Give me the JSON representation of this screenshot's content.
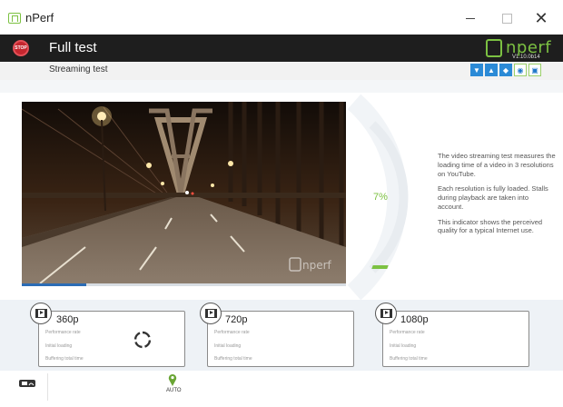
{
  "window": {
    "title": "nPerf",
    "controls": {
      "minimize": "minimize-icon",
      "maximize": "maximize-icon",
      "close": "✕"
    }
  },
  "header": {
    "stop_label": "STOP",
    "title": "Full test",
    "brand": "nperf",
    "version": "V1.10.0b14"
  },
  "subheader": {
    "label": "Streaming test",
    "tools": [
      "chevron-down-icon",
      "chevron-up-icon",
      "expand-horizontal-icon",
      "globe-icon",
      "screenshot-icon"
    ],
    "tool_glyphs": [
      "▼",
      "▲",
      "◆",
      "◉",
      "▣"
    ]
  },
  "main": {
    "progress_percent": "7%",
    "progress_value": 0.07,
    "video_watermark": "nperf",
    "video_progress": 0.2,
    "info": [
      "The video streaming test measures the loading time of a video in 3 resolutions on YouTube.",
      "Each resolution is fully loaded. Stalls during playback are taken into account.",
      "This indicator shows the perceived quality for a typical Internet use."
    ]
  },
  "results": [
    {
      "resolution": "360p",
      "metrics": [
        "Performance rate",
        "Initial loading",
        "Buffering total time"
      ],
      "status": "loading"
    },
    {
      "resolution": "720p",
      "metrics": [
        "Performance rate",
        "Initial loading",
        "Buffering total time"
      ],
      "status": "pending"
    },
    {
      "resolution": "1080p",
      "metrics": [
        "Performance rate",
        "Initial loading",
        "Buffering total time"
      ],
      "status": "pending"
    }
  ],
  "footer": {
    "connection_icon": "wifi-connection-icon",
    "location_mode": "AUTO"
  },
  "colors": {
    "accent_green": "#7cc142",
    "stop_red": "#c4262e",
    "header_bg": "#1e1e1e",
    "band_bg": "#eef2f6"
  }
}
